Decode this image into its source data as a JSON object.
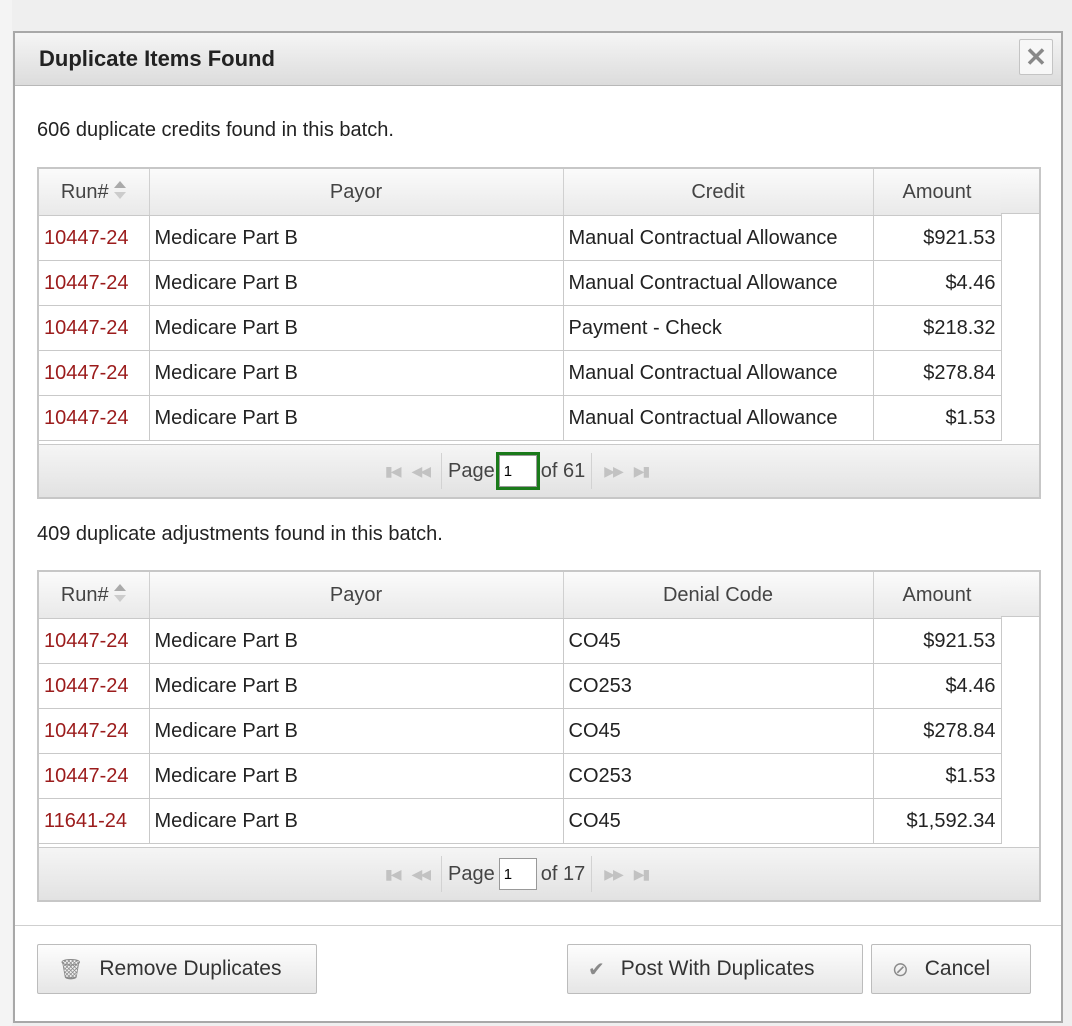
{
  "dialog": {
    "title": "Duplicate Items Found"
  },
  "credits": {
    "summary": "606 duplicate credits found in this batch.",
    "columns": [
      "Run#",
      "Payor",
      "Credit",
      "Amount"
    ],
    "rows": [
      [
        "10447-24",
        "Medicare Part B",
        "Manual Contractual Allowance",
        "$921.53"
      ],
      [
        "10447-24",
        "Medicare Part B",
        "Manual Contractual Allowance",
        "$4.46"
      ],
      [
        "10447-24",
        "Medicare Part B",
        "Payment - Check",
        "$218.32"
      ],
      [
        "10447-24",
        "Medicare Part B",
        "Manual Contractual Allowance",
        "$278.84"
      ],
      [
        "10447-24",
        "Medicare Part B",
        "Manual Contractual Allowance",
        "$1.53"
      ]
    ],
    "pager": {
      "page_label": "Page",
      "page_value": "1",
      "of_label": "of 61"
    }
  },
  "adjustments": {
    "summary": "409 duplicate adjustments found in this batch.",
    "columns": [
      "Run#",
      "Payor",
      "Denial Code",
      "Amount"
    ],
    "rows": [
      [
        "10447-24",
        "Medicare Part B",
        "CO45",
        "$921.53"
      ],
      [
        "10447-24",
        "Medicare Part B",
        "CO253",
        "$4.46"
      ],
      [
        "10447-24",
        "Medicare Part B",
        "CO45",
        "$278.84"
      ],
      [
        "10447-24",
        "Medicare Part B",
        "CO253",
        "$1.53"
      ],
      [
        "11641-24",
        "Medicare Part B",
        "CO45",
        "$1,592.34"
      ]
    ],
    "pager": {
      "page_label": "Page",
      "page_value": "1",
      "of_label": "of 17"
    }
  },
  "buttons": {
    "remove": "Remove Duplicates",
    "post": "Post With Duplicates",
    "cancel": "Cancel"
  },
  "icons": {
    "close": "close-icon",
    "remove": "trash-icon",
    "post": "checkmark-icon",
    "cancel": "cancel-icon"
  },
  "colors": {
    "run_link": "#9b1b1b",
    "focus_outline": "#1a7a1a"
  }
}
